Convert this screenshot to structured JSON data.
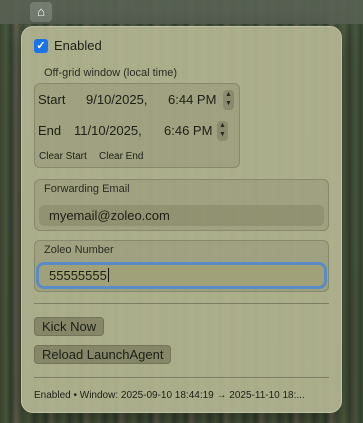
{
  "menubar": {
    "icon": "house-icon"
  },
  "enabled": {
    "label": "Enabled",
    "checked": true
  },
  "offgrid": {
    "title": "Off-grid window (local time)",
    "start": {
      "label": "Start",
      "date": "9/10/2025,",
      "time": "6:44 PM"
    },
    "end": {
      "label": "End",
      "date": "11/10/2025,",
      "time": "6:46 PM"
    },
    "clear_start": "Clear Start",
    "clear_end": "Clear End"
  },
  "forwarding": {
    "label": "Forwarding Email",
    "value": "myemail@zoleo.com"
  },
  "zoleo": {
    "label": "Zoleo Number",
    "value": "55555555"
  },
  "actions": {
    "kick_now": "Kick Now",
    "reload": "Reload LaunchAgent"
  },
  "status": "Enabled • Window: 2025-09-10 18:44:19 → 2025-11-10 18:..."
}
